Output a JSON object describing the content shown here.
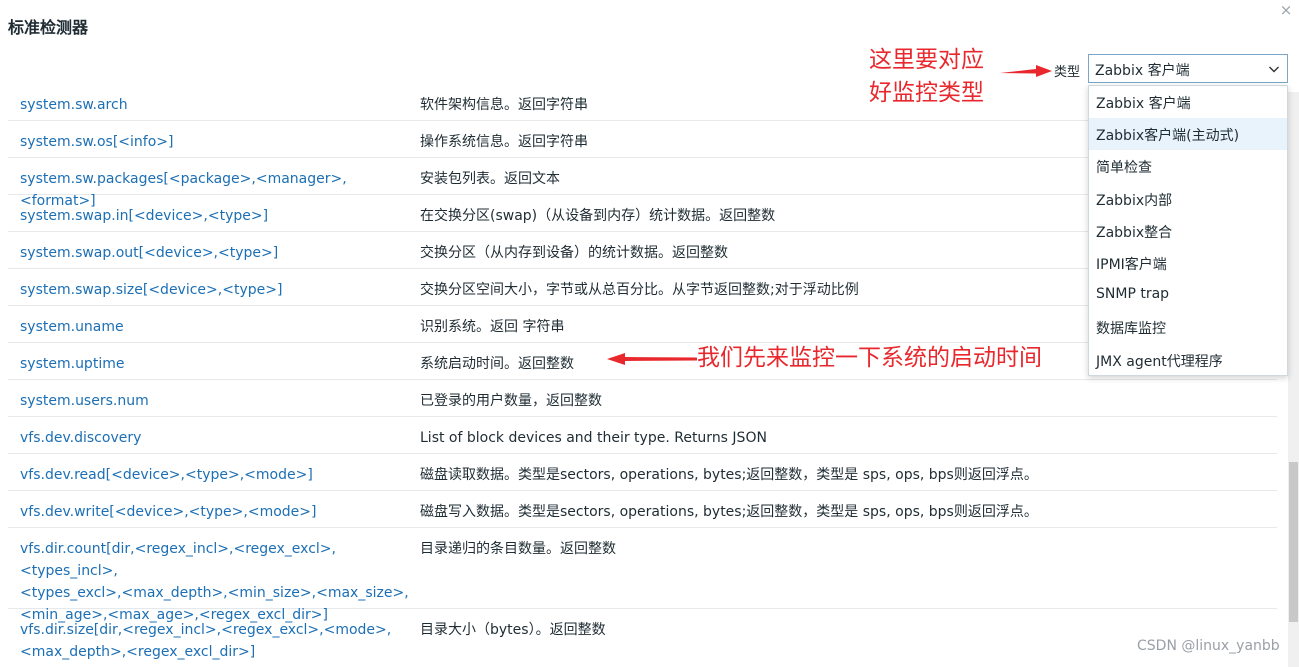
{
  "dialog": {
    "title": "标准检测器",
    "close": "×"
  },
  "filter": {
    "type_label": "类型",
    "selected": "Zabbix 客户端",
    "options": [
      "Zabbix 客户端",
      "Zabbix客户端(主动式)",
      "简单检查",
      "Zabbix内部",
      "Zabbix整合",
      "IPMI客户端",
      "SNMP trap",
      "数据库监控",
      "JMX agent代理程序"
    ]
  },
  "items": [
    {
      "key": "system.sw.arch",
      "desc": "软件架构信息。返回字符串"
    },
    {
      "key": "system.sw.os[<info>]",
      "desc": "操作系统信息。返回字符串"
    },
    {
      "key": "system.sw.packages[<package>,<manager>,<format>]",
      "desc": "安装包列表。返回文本"
    },
    {
      "key": "system.swap.in[<device>,<type>]",
      "desc": "在交换分区(swap)（从设备到内存）统计数据。返回整数"
    },
    {
      "key": "system.swap.out[<device>,<type>]",
      "desc": "交换分区（从内存到设备）的统计数据。返回整数"
    },
    {
      "key": "system.swap.size[<device>,<type>]",
      "desc": "交换分区空间大小，字节或从总百分比。从字节返回整数;对于浮动比例"
    },
    {
      "key": "system.uname",
      "desc": "识别系统。返回 字符串"
    },
    {
      "key": "system.uptime",
      "desc": "系统启动时间。返回整数"
    },
    {
      "key": "system.users.num",
      "desc": "已登录的用户数量，返回整数"
    },
    {
      "key": "vfs.dev.discovery",
      "desc": "List of block devices and their type. Returns JSON"
    },
    {
      "key": "vfs.dev.read[<device>,<type>,<mode>]",
      "desc": "磁盘读取数据。类型是sectors, operations, bytes;返回整数，类型是 sps, ops, bps则返回浮点。"
    },
    {
      "key": "vfs.dev.write[<device>,<type>,<mode>]",
      "desc": "磁盘写入数据。类型是sectors, operations, bytes;返回整数，类型是 sps, ops, bps则返回浮点。"
    },
    {
      "key": "vfs.dir.count[dir,<regex_incl>,<regex_excl>,<types_incl>,\n<types_excl>,<max_depth>,<min_size>,<max_size>,\n<min_age>,<max_age>,<regex_excl_dir>]",
      "desc": "目录递归的条目数量。返回整数"
    },
    {
      "key": "vfs.dir.size[dir,<regex_incl>,<regex_excl>,<mode>,\n<max_depth>,<regex_excl_dir>]",
      "desc": "目录大小（bytes）。返回整数"
    }
  ],
  "annotations": {
    "type_note_line1": "这里要对应",
    "type_note_line2": "好监控类型",
    "uptime_note": "我们先来监控一下系统的启动时间"
  },
  "watermark": "CSDN @linux_yanbb",
  "colors": {
    "link": "#1c6fb4",
    "annotation": "#e8282c",
    "option_hover": "#e8f3fb"
  }
}
